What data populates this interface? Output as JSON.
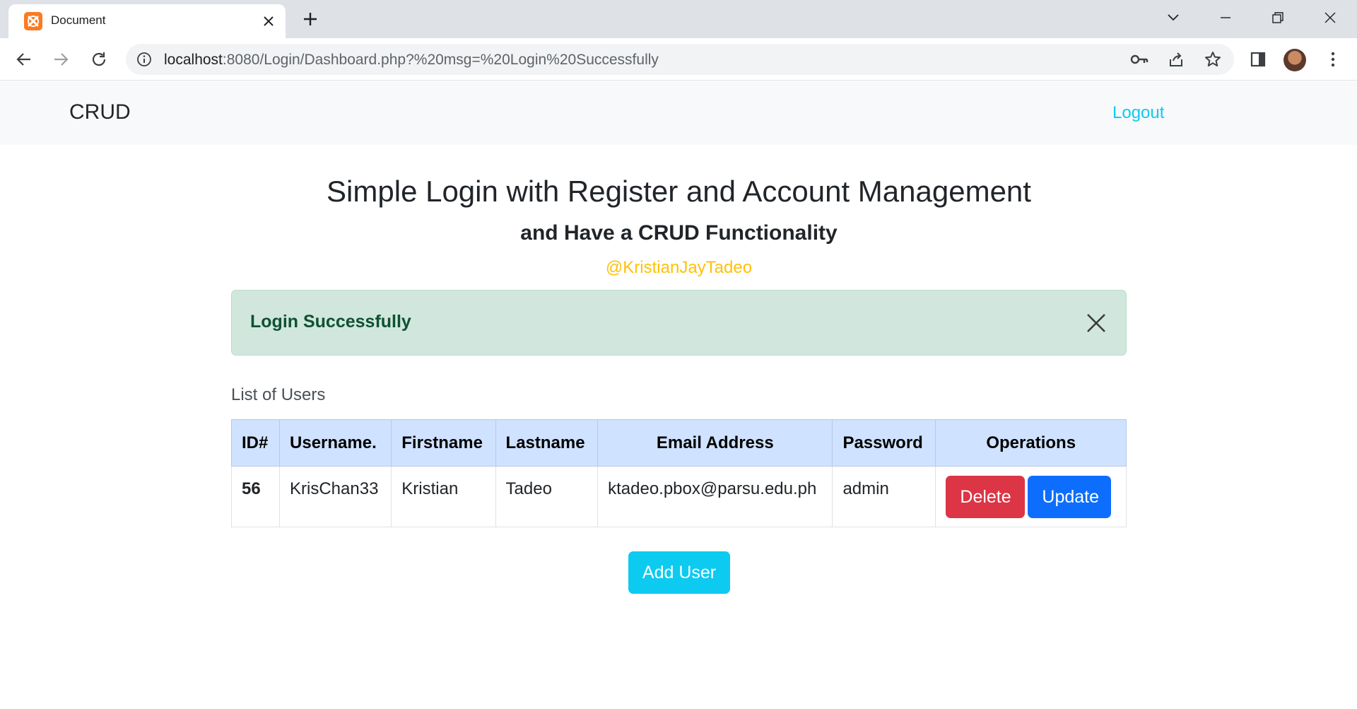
{
  "browser": {
    "tab_title": "Document",
    "url_host": "localhost",
    "url_rest": ":8080/Login/Dashboard.php?%20msg=%20Login%20Successfully"
  },
  "navbar": {
    "brand": "CRUD",
    "logout": "Logout"
  },
  "header": {
    "title": "Simple Login with Register and Account Management",
    "subtitle": "and Have a CRUD Functionality",
    "author": "@KristianJayTadeo"
  },
  "alert": {
    "message": "Login Successfully"
  },
  "users": {
    "label": "List of Users",
    "columns": [
      "ID#",
      "Username.",
      "Firstname",
      "Lastname",
      "Email Address",
      "Password",
      "Operations"
    ],
    "rows": [
      {
        "id": "56",
        "username": "KrisChan33",
        "firstname": "Kristian",
        "lastname": "Tadeo",
        "email": "ktadeo.pbox@parsu.edu.ph",
        "password": "admin"
      }
    ],
    "delete_label": "Delete",
    "update_label": "Update"
  },
  "add_user_label": "Add User",
  "colors": {
    "alert_bg": "#d1e7dd",
    "table_header_bg": "#cfe2ff",
    "danger": "#dc3545",
    "primary": "#0d6efd",
    "info": "#0dcaf0",
    "warning": "#ffc107"
  }
}
